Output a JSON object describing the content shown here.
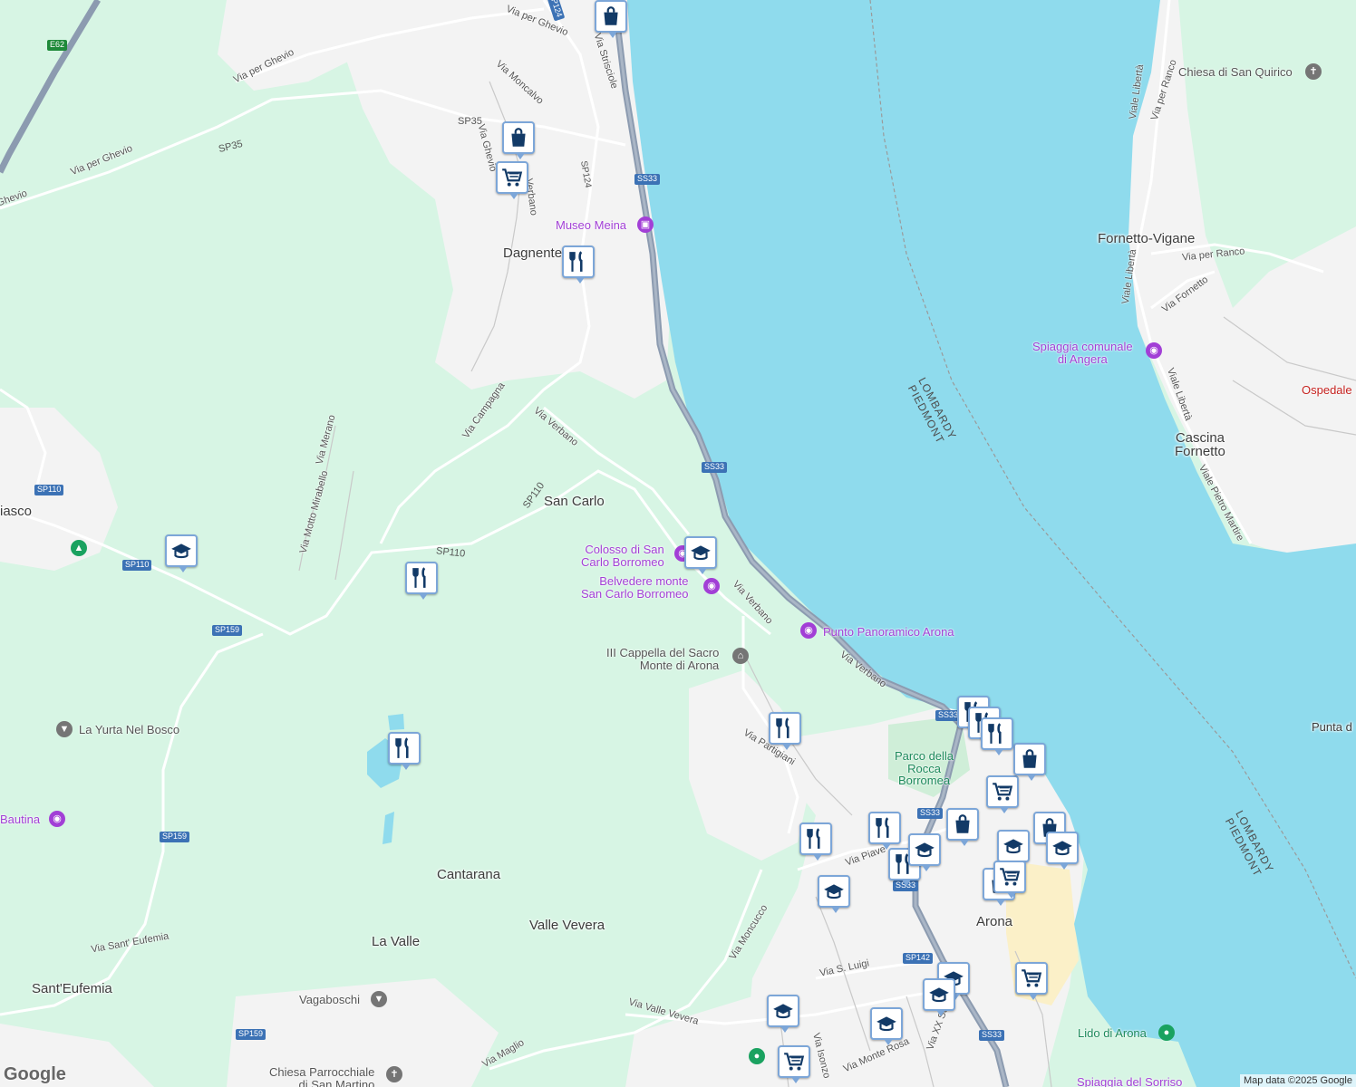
{
  "map": {
    "places": {
      "dagnente": "Dagnente",
      "san_carlo": "San Carlo",
      "fornetto_vigane": "Fornetto-Vigane",
      "cascina_fornetto": "Cascina\nFornetto",
      "cantarana": "Cantarana",
      "valle_vevera": "Valle Vevera",
      "la_valle": "La Valle",
      "santeufemia": "Sant'Eufemia",
      "arona": "Arona",
      "iasco": "iasco",
      "punta": "Punta d"
    },
    "pois": {
      "museo_meina": "Museo Meina",
      "colosso": "Colosso di San\nCarlo Borromeo",
      "belvedere": "Belvedere monte\nSan Carlo Borromeo",
      "punto_panoramico": "Punto Panoramico Arona",
      "cappella": "III Cappella del Sacro\nMonte di Arona",
      "spiaggia_angera": "Spiaggia comunale\ndi Angera",
      "chiesa_quirico": "Chiesa di San Quirico",
      "ospedale": "Ospedale",
      "yurta": "La Yurta Nel Bosco",
      "bautina": "Bautina",
      "vagaboschi": "Vagaboschi",
      "parco_rocca": "Parco della\nRocca\nBorromea",
      "lido_arona": "Lido di Arona",
      "spiaggia_sorriso": "Spiaggia del Sorriso",
      "chiesa_martino": "Chiesa Parrocchiale\ndi San Martino"
    },
    "streets": {
      "via_per_ghevio_1": "Via per Ghevio",
      "via_per_ghevio_2": "Via per Ghevio",
      "via_per_ghevio_3": "Via per Ghevio",
      "via_ghevio": "Via Ghevio",
      "ghevio": "Ghevio",
      "via_moncalvo": "Via Moncalvo",
      "via_strisciole": "Via Strisciole",
      "verbano_1": "Verbano",
      "via_campagna": "Via Campagna",
      "via_verbano_1": "Via Verbano",
      "via_verbano_2": "Via Verbano",
      "via_verbano_3": "Via Verbano",
      "via_merano": "Via Merano",
      "via_motto_mirabello": "Via Motto Mirabello",
      "via_partigiani": "Via Partigiani",
      "via_piave": "Via Piave",
      "via_moncucco": "Via Moncucco",
      "via_s_luigi": "Via S. Luigi",
      "via_valle_vevera": "Via Valle Vevera",
      "via_maglio": "Via Maglio",
      "via_santeufemia": "Via Sant' Eufemia",
      "via_liberta_1": "Viale Libertà",
      "via_liberta_2": "Viale Libertà",
      "via_liberta_3": "Viale Libertà",
      "via_per_ranco_1": "Via per Ranco",
      "via_per_ranco_2": "Via per Ranco",
      "via_fornetto": "Via Fornetto",
      "via_pietro_martire": "Viale Pietro Martire",
      "via_monte_rosa": "Via Monte Rosa",
      "via_isonzo": "Via Isonzo",
      "via_xx": "Via XX Se"
    },
    "shields": {
      "e62": "E62",
      "sp124_a": "SP124",
      "sp124_b": "SP124",
      "sp35_a": "SP35",
      "sp35_b": "SP35",
      "ss33_a": "SS33",
      "ss33_b": "SS33",
      "ss33_c": "SS33",
      "ss33_d": "SS33",
      "ss33_e": "SS33",
      "ss33_f": "SS33",
      "sp110_a": "SP110",
      "sp110_b": "SP110",
      "sp110_c": "SP110",
      "sp110_d": "SP110",
      "sp159_a": "SP159",
      "sp159_b": "SP159",
      "sp159_c": "SP159",
      "sp142": "SP142"
    },
    "border_labels": {
      "lombardy_1": "LOMBARDY\nPIEDMONT",
      "lombardy_2": "LOMBARDY\nPIEDMONT"
    },
    "markers": [
      {
        "type": "shopping-bag"
      },
      {
        "type": "shopping-bag"
      },
      {
        "type": "shopping-cart"
      },
      {
        "type": "restaurant"
      },
      {
        "type": "school"
      },
      {
        "type": "restaurant"
      },
      {
        "type": "school"
      },
      {
        "type": "restaurant"
      },
      {
        "type": "restaurant"
      },
      {
        "type": "restaurant"
      },
      {
        "type": "restaurant"
      },
      {
        "type": "restaurant"
      },
      {
        "type": "restaurant"
      },
      {
        "type": "shopping-bag"
      },
      {
        "type": "shopping-cart"
      },
      {
        "type": "shopping-bag"
      },
      {
        "type": "shopping-bag"
      },
      {
        "type": "school"
      },
      {
        "type": "school"
      },
      {
        "type": "restaurant"
      },
      {
        "type": "restaurant"
      },
      {
        "type": "school"
      },
      {
        "type": "shopping-bag"
      },
      {
        "type": "school"
      },
      {
        "type": "school"
      },
      {
        "type": "shopping-cart"
      },
      {
        "type": "school"
      },
      {
        "type": "school"
      },
      {
        "type": "school"
      },
      {
        "type": "shopping-cart"
      },
      {
        "type": "shopping-cart"
      }
    ],
    "colors": {
      "water": "#8fdbed",
      "forest": "#d7f5e4",
      "urban": "#f3f3f3",
      "road": "#ffffff",
      "highway": "#8c9bb0",
      "poi_purple": "#a23fd6",
      "marker_border": "#7ca6d8",
      "marker_icon": "#123a67"
    },
    "logo": "Google",
    "attribution": "Map data ©2025 Google"
  }
}
